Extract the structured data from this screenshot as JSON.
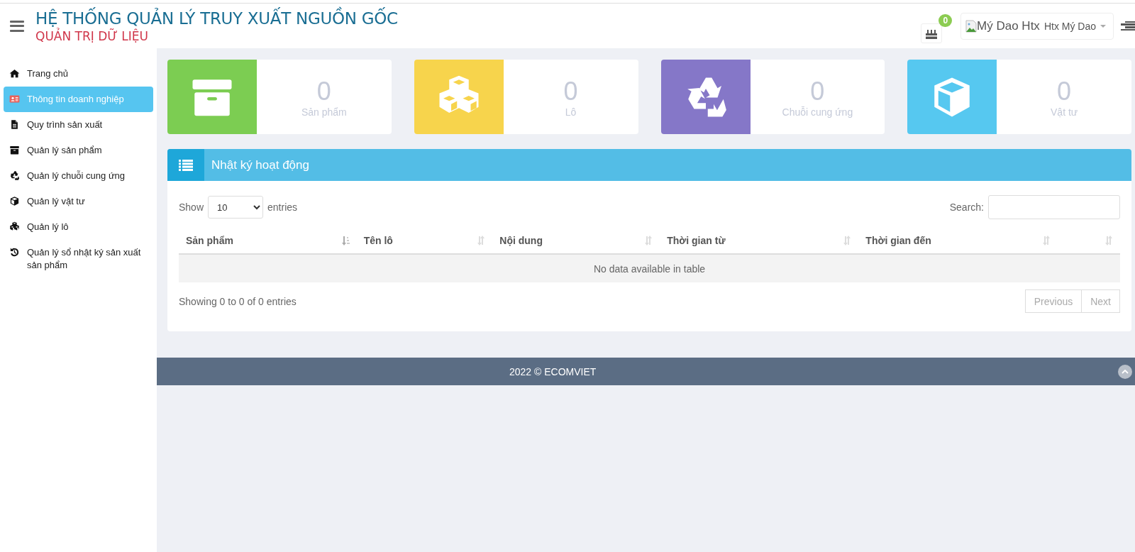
{
  "header": {
    "title": "HỆ THỐNG QUẢN LÝ TRUY XUẤT NGUỒN GỐC",
    "subtitle": "QUẢN TRỊ DỮ LIỆU",
    "notification_count": "0",
    "user": {
      "image_alt": "Mý Dao Htx",
      "name": "Htx Mý Dao"
    }
  },
  "sidebar": {
    "items": [
      {
        "label": "Trang chủ",
        "kind": "home",
        "selected": false
      },
      {
        "label": "Thông tin doanh nghiệp",
        "kind": "idcard",
        "selected": true
      },
      {
        "label": "Quy trình sản xuất",
        "kind": "file",
        "selected": false
      },
      {
        "label": "Quản lý sản phẩm",
        "kind": "archive",
        "selected": false
      },
      {
        "label": "Quản lý chuỗi cung ứng",
        "kind": "recycle",
        "selected": false
      },
      {
        "label": "Quản lý vật tư",
        "kind": "cube",
        "selected": false
      },
      {
        "label": "Quản lý lô",
        "kind": "cubes",
        "selected": false
      },
      {
        "label": "Quản lý sổ nhật ký sản xuất sản phẩm",
        "kind": "history",
        "selected": false
      }
    ]
  },
  "stats": [
    {
      "value": "0",
      "label": "Sản phẩm",
      "kind": "archive",
      "color": "#7ccd52"
    },
    {
      "value": "0",
      "label": "Lô",
      "kind": "cubes",
      "color": "#f7d44c"
    },
    {
      "value": "0",
      "label": "Chuỗi cung ứng",
      "kind": "recycle",
      "color": "#8577c8"
    },
    {
      "value": "0",
      "label": "Vật tư",
      "kind": "cube",
      "color": "#56c8f0"
    }
  ],
  "panel": {
    "title": "Nhật ký hoạt động",
    "length_label_before": "Show",
    "length_value": "10",
    "length_label_after": "entries",
    "search_label": "Search:",
    "table": {
      "columns": [
        {
          "label": "Sản phẩm",
          "sorted": true
        },
        {
          "label": "Tên lô",
          "sorted": false
        },
        {
          "label": "Nội dung",
          "sorted": false
        },
        {
          "label": "Thời gian từ",
          "sorted": false
        },
        {
          "label": "Thời gian đến",
          "sorted": false
        },
        {
          "sorted": false
        }
      ],
      "empty_message": "No data available in table"
    },
    "info": "Showing 0 to 0 of 0 entries",
    "pagination": [
      {
        "label": "Previous",
        "disabled": true
      },
      {
        "label": "Next",
        "disabled": true
      }
    ]
  },
  "footer": {
    "text": "2022 © ECOMVIET"
  }
}
